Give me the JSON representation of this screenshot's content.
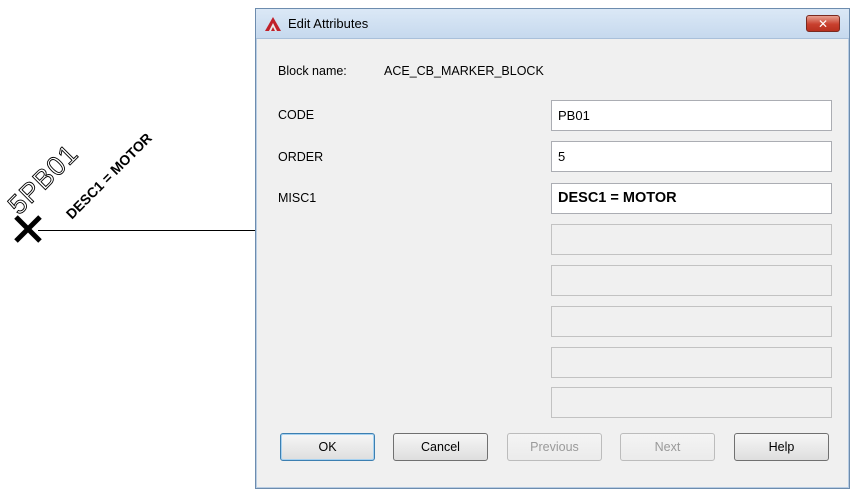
{
  "canvas": {
    "marker_code_text": "5PB01",
    "marker_desc_text": "DESC1 = MOTOR"
  },
  "dialog": {
    "title": "Edit Attributes",
    "close_label": "✕",
    "block_name_label": "Block name:",
    "block_name_value": "ACE_CB_MARKER_BLOCK",
    "attributes": [
      {
        "label": "CODE",
        "value": "PB01"
      },
      {
        "label": "ORDER",
        "value": "5"
      },
      {
        "label": "MISC1",
        "value": "DESC1 = MOTOR"
      }
    ],
    "empty_fields": [
      "",
      "",
      "",
      "",
      ""
    ],
    "buttons": {
      "ok": "OK",
      "cancel": "Cancel",
      "previous": "Previous",
      "next": "Next",
      "help": "Help"
    }
  },
  "colors": {
    "titlebar": "#c6d9ee",
    "close_button": "#c8402e",
    "dialog_bg": "#f0f0f0",
    "app_icon": "#c0202a"
  }
}
